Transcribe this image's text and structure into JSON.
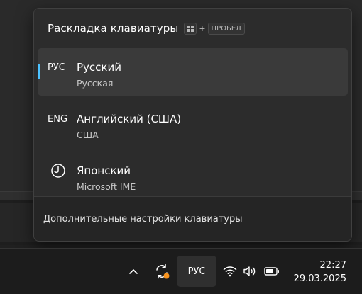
{
  "flyout": {
    "title": "Раскладка клавиатуры",
    "shortcut_key": "ПРОБЕЛ",
    "shortcut_plus": "+",
    "languages": [
      {
        "code": "РУС",
        "name": "Русский",
        "layout": "Русская",
        "selected": true
      },
      {
        "code": "ENG",
        "name": "Английский (США)",
        "layout": "США",
        "selected": false
      },
      {
        "code": "",
        "icon": "ime-circle-icon",
        "name": "Японский",
        "layout": "Microsoft IME",
        "selected": false
      }
    ],
    "footer_link": "Дополнительные настройки клавиатуры"
  },
  "taskbar": {
    "language_button": "РУС",
    "time": "22:27",
    "date": "29.03.2025",
    "icons": [
      "chevron-up-icon",
      "sync-warning-icon",
      "wifi-icon",
      "volume-icon",
      "battery-icon"
    ]
  },
  "colors": {
    "accent": "#4cc2ff",
    "warning": "#f7931e",
    "flyout_bg": "#2c2c2c",
    "selected_bg": "#3a3a3a"
  }
}
